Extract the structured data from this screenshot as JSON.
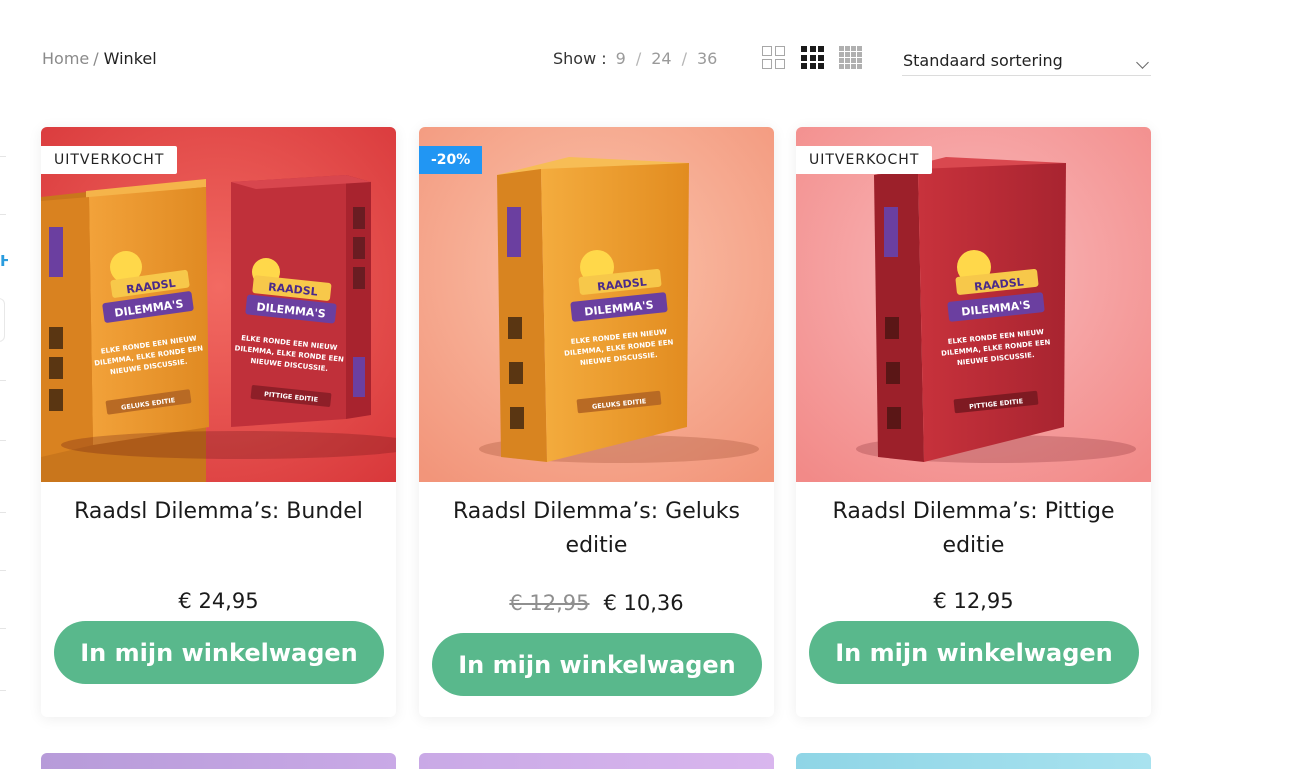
{
  "breadcrumb": {
    "home": "Home",
    "separator": "/",
    "current": "Winkel"
  },
  "toolbar": {
    "show_label": "Show :",
    "show_options": [
      "9",
      "24",
      "36"
    ],
    "view_icons": [
      "grid-2-icon",
      "grid-3-icon",
      "grid-4-icon"
    ],
    "active_view": "grid-3-icon",
    "sort_value": "Standaard sortering"
  },
  "colors": {
    "button": "#59b88c",
    "sale_badge": "#2196f3"
  },
  "products": [
    {
      "badge": "UITVERKOCHT",
      "title": "Raadsl Dilemma’s: Bundel",
      "price": "€ 24,95",
      "button": "In mijn winkelwagen",
      "image": {
        "boxes": [
          {
            "logo_top": "RAADSL",
            "logo_bottom": "DILEMMA'S",
            "text": [
              "ELKE RONDE EEN NIEUW",
              "DILEMMA, ELKE RONDE EEN",
              "NIEUWE DISCUSSIE."
            ],
            "edition": "GELUKS EDITIE",
            "side_text": "RAADSL DILEMMA'S"
          },
          {
            "logo_top": "RAADSL",
            "logo_bottom": "DILEMMA'S",
            "text": [
              "ELKE RONDE EEN NIEUW",
              "DILEMMA, ELKE RONDE EEN",
              "NIEUWE DISCUSSIE."
            ],
            "edition": "PITTIGE EDITIE",
            "side_text": "RAADSL DILEMMA'S"
          }
        ]
      }
    },
    {
      "badge": "-20%",
      "title": "Raadsl Dilemma’s: Geluks editie",
      "old_price": "€ 12,95",
      "price": "€ 10,36",
      "button": "In mijn winkelwagen",
      "image": {
        "boxes": [
          {
            "logo_top": "RAADSL",
            "logo_bottom": "DILEMMA'S",
            "text": [
              "ELKE RONDE EEN NIEUW",
              "DILEMMA, ELKE RONDE EEN",
              "NIEUWE DISCUSSIE."
            ],
            "edition": "GELUKS EDITIE",
            "side_text": "RAADSL DILEMMA'S"
          }
        ]
      }
    },
    {
      "badge": "UITVERKOCHT",
      "title": "Raadsl Dilemma’s: Pittige editie",
      "price": "€ 12,95",
      "button": "In mijn winkelwagen",
      "image": {
        "boxes": [
          {
            "logo_top": "RAADSL",
            "logo_bottom": "DILEMMA'S",
            "text": [
              "ELKE RONDE EEN NIEUW",
              "DILEMMA, ELKE RONDE EEN",
              "NIEUWE DISCUSSIE."
            ],
            "edition": "PITTIGE EDITIE",
            "side_text": "RAADSL DILEMMA'S"
          }
        ]
      }
    }
  ]
}
